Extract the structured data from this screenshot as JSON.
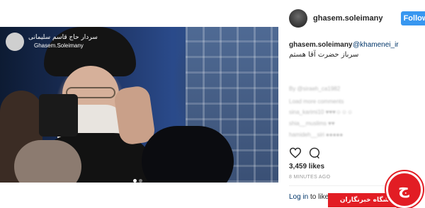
{
  "post": {
    "watermark_text": "سردار حاج قاسم سلیمانی",
    "watermark_handle": "Ghasem.Soleimany",
    "carousel_total": 2,
    "carousel_current": 1
  },
  "header": {
    "username": "ghasem.soleimany",
    "follow_label": "Follow"
  },
  "caption": {
    "username": "ghasem.soleimany",
    "mention": "@khamenei_ir",
    "text": "سرباز حضرت آقا هستم"
  },
  "comments": {
    "blurred": [
      "By @siraeh_ca1982",
      "Load more comments",
      "sina_karimi10 ♥♥♥☺☺☺",
      "shia__muslims ♥♥",
      "hamideh__siri ●●●●●"
    ]
  },
  "actions": {
    "like_icon": "heart-icon",
    "comment_icon": "comment-icon"
  },
  "likes": "3,459 likes",
  "time": "8 MINUTES AGO",
  "login": {
    "link_text": "Log in",
    "rest_text": "to like"
  },
  "badge": {
    "text": "باشگاه خبرنگاران",
    "glyph": "ج",
    "color": "#e21d24"
  },
  "colors": {
    "follow_button": "#3897f0",
    "link": "#003569"
  }
}
